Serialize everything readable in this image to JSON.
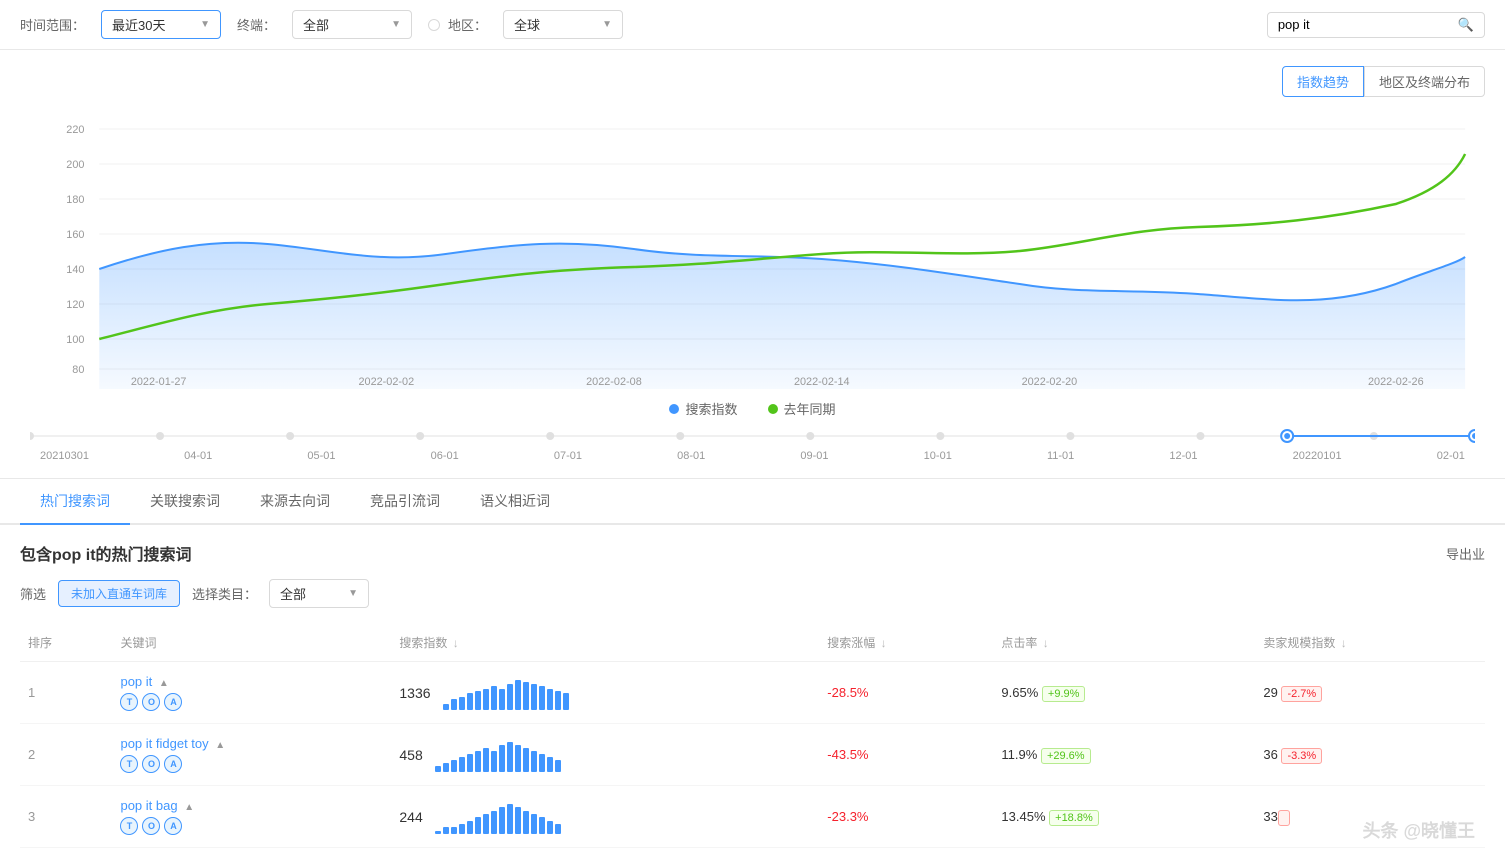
{
  "topbar": {
    "time_label": "时间范围：",
    "time_value": "最近30天",
    "terminal_label": "终端：",
    "terminal_value": "全部",
    "region_label": "地区：",
    "region_value": "全球",
    "search_placeholder": "pop it",
    "search_value": "pop it"
  },
  "chart": {
    "tab_trend": "指数趋势",
    "tab_region": "地区及终端分布",
    "y_labels": [
      "220",
      "200",
      "180",
      "160",
      "140",
      "120",
      "100",
      "80"
    ],
    "legend_search": "搜索指数",
    "legend_lastyear": "去年同期",
    "x_labels_main": [
      "2022-01-27",
      "2022-02-02",
      "2022-02-08",
      "2022-02-14",
      "2022-02-20",
      "2022-02-26"
    ],
    "x_labels_timeline": [
      "20210301",
      "04-01",
      "05-01",
      "06-01",
      "07-01",
      "08-01",
      "09-01",
      "10-01",
      "11-01",
      "12-01",
      "20220101",
      "02-01"
    ]
  },
  "tabs": {
    "items": [
      "热门搜索词",
      "关联搜索词",
      "来源去向词",
      "竞品引流词",
      "语义相近词"
    ]
  },
  "section": {
    "title": "包含pop it的热门搜索词",
    "export": "导出业",
    "filter_label": "筛选",
    "filter_tag": "未加入直通车词库",
    "category_label": "选择类目：",
    "category_value": "全部"
  },
  "table": {
    "columns": [
      "排序",
      "关键词",
      "搜索指数↓",
      "搜索涨幅↓",
      "点击率↓",
      "卖家规模指数↓"
    ],
    "rows": [
      {
        "rank": "1",
        "keyword": "pop it",
        "tags": [
          "T",
          "O",
          "A"
        ],
        "search_index": "1336",
        "growth": "-28.5%",
        "click_rate": "9.65%",
        "click_growth": "+9.9%",
        "seller_index": "29",
        "seller_growth": "-2.7%",
        "bars": [
          3,
          5,
          6,
          8,
          9,
          10,
          11,
          10,
          12,
          14,
          13,
          12,
          11,
          10,
          9,
          8
        ]
      },
      {
        "rank": "2",
        "keyword": "pop it fidget toy",
        "tags": [
          "T",
          "O",
          "A"
        ],
        "search_index": "458",
        "growth": "-43.5%",
        "click_rate": "11.9%",
        "click_growth": "+29.6%",
        "seller_index": "36",
        "seller_growth": "-3.3%",
        "bars": [
          2,
          3,
          4,
          5,
          6,
          7,
          8,
          7,
          9,
          10,
          9,
          8,
          7,
          6,
          5,
          4
        ]
      },
      {
        "rank": "3",
        "keyword": "pop it bag",
        "tags": [
          "T",
          "O",
          "A"
        ],
        "search_index": "244",
        "growth": "-23.3%",
        "click_rate": "13.45%",
        "click_growth": "+18.8%",
        "seller_index": "33",
        "seller_growth": "",
        "bars": [
          1,
          2,
          2,
          3,
          4,
          5,
          6,
          7,
          8,
          9,
          8,
          7,
          6,
          5,
          4,
          3
        ]
      }
    ]
  },
  "watermark": "头条 @晓懂王"
}
